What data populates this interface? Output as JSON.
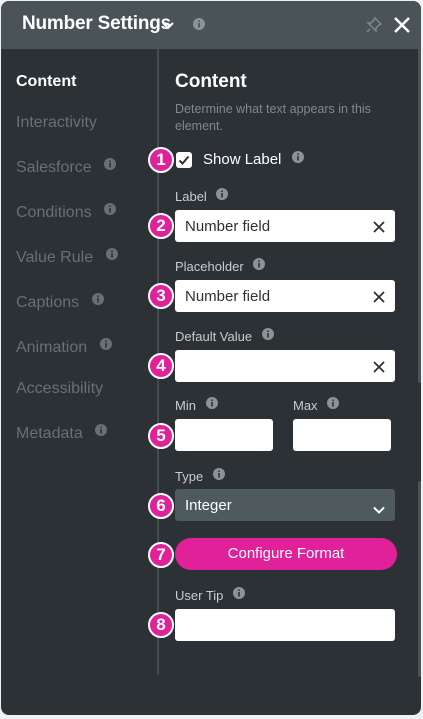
{
  "header": {
    "title": "Number Settings"
  },
  "nav": {
    "items": [
      {
        "label": "Content"
      },
      {
        "label": "Interactivity"
      },
      {
        "label": "Salesforce"
      },
      {
        "label": "Conditions"
      },
      {
        "label": "Value Rule"
      },
      {
        "label": "Captions"
      },
      {
        "label": "Animation"
      },
      {
        "label": "Accessibility"
      },
      {
        "label": "Metadata"
      }
    ]
  },
  "content": {
    "title": "Content",
    "description": "Determine what text appears in this element.",
    "show_label": {
      "label": "Show Label",
      "checked": true
    },
    "label_field": {
      "label": "Label",
      "value": "Number field"
    },
    "placeholder_field": {
      "label": "Placeholder",
      "value": "Number field"
    },
    "default_value_field": {
      "label": "Default Value",
      "value": ""
    },
    "min_field": {
      "label": "Min",
      "value": ""
    },
    "max_field": {
      "label": "Max",
      "value": ""
    },
    "type_field": {
      "label": "Type",
      "value": "Integer"
    },
    "configure_button": "Configure Format",
    "user_tip_field": {
      "label": "User Tip",
      "value": ""
    }
  },
  "badges": [
    "1",
    "2",
    "3",
    "4",
    "5",
    "6",
    "7",
    "8"
  ],
  "colors": {
    "accent": "#e0219a",
    "panel_bg": "#2b3135",
    "header_bg": "#4a5357"
  }
}
